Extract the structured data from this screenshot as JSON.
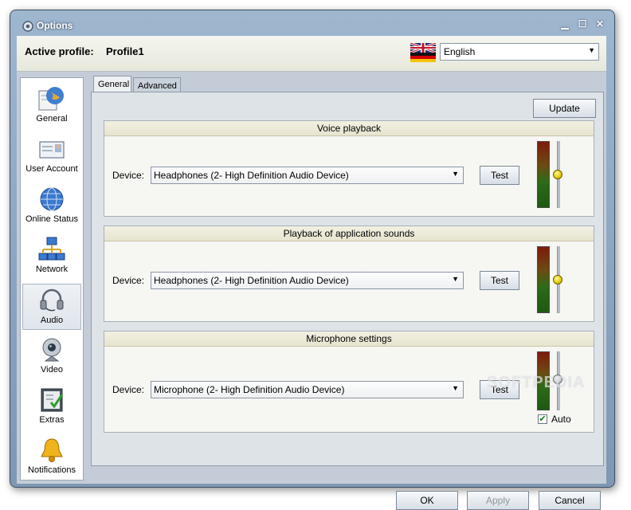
{
  "window": {
    "title": "Options",
    "controls": [
      "▁",
      "☐",
      "✕"
    ]
  },
  "header": {
    "active_profile_label": "Active profile:",
    "active_profile_value": "Profile1",
    "language": "English"
  },
  "sidebar": {
    "items": [
      {
        "label": "General",
        "icon": "globe-notepad-icon"
      },
      {
        "label": "User Account",
        "icon": "id-card-icon"
      },
      {
        "label": "Online Status",
        "icon": "globe-icon"
      },
      {
        "label": "Network",
        "icon": "network-icon"
      },
      {
        "label": "Audio",
        "icon": "headset-icon",
        "selected": true
      },
      {
        "label": "Video",
        "icon": "webcam-icon"
      },
      {
        "label": "Extras",
        "icon": "checklist-icon"
      },
      {
        "label": "Notifications",
        "icon": "bell-icon"
      }
    ]
  },
  "tabs": [
    {
      "label": "General",
      "active": true
    },
    {
      "label": "Advanced",
      "active": false
    }
  ],
  "panel": {
    "update_label": "Update",
    "voice": {
      "title": "Voice playback",
      "device_label": "Device:",
      "device_value": "Headphones (2- High Definition Audio Device)",
      "test_label": "Test"
    },
    "app_sounds": {
      "title": "Playback of application sounds",
      "device_label": "Device:",
      "device_value": "Headphones (2- High Definition Audio Device)",
      "test_label": "Test"
    },
    "mic": {
      "title": "Microphone settings",
      "device_label": "Device:",
      "device_value": "Microphone (2- High Definition Audio Device)",
      "test_label": "Test",
      "auto_label": "Auto",
      "auto_checked": true
    },
    "watermark": "SOFTPEDIA"
  },
  "footer": {
    "ok_label": "OK",
    "apply_label": "Apply",
    "cancel_label": "Cancel"
  }
}
